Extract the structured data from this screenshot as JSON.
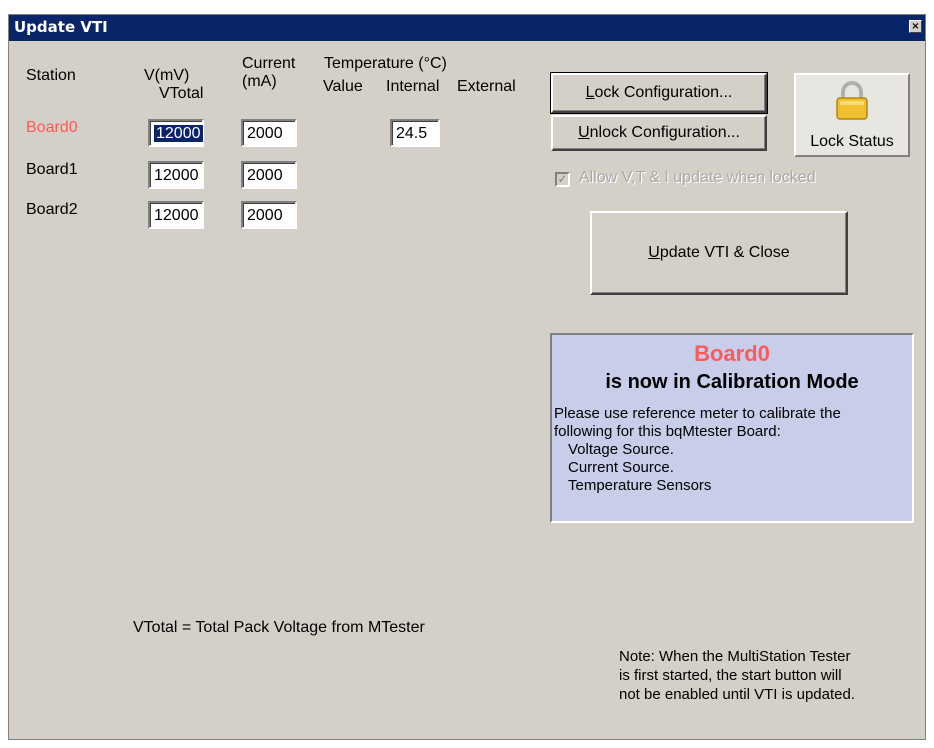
{
  "window": {
    "title": "Update VTI",
    "close_symbol": "×"
  },
  "headers": {
    "station": "Station",
    "voltage_line1": "V(mV)",
    "voltage_line2": "VTotal",
    "current_line1": "Current",
    "current_line2": "(mA)",
    "temperature": "Temperature (°C)",
    "temp_value": "Value",
    "temp_internal": "Internal",
    "temp_external": "External"
  },
  "boards": [
    {
      "name": "Board0",
      "voltage": "12000",
      "current": "2000",
      "temp_internal": "24.5",
      "highlight_color": "#ff5a5a"
    },
    {
      "name": "Board1",
      "voltage": "12000",
      "current": "2000"
    },
    {
      "name": "Board2",
      "voltage": "12000",
      "current": "2000"
    }
  ],
  "buttons": {
    "lock_prefix": "",
    "lock_hotkey": "L",
    "lock_rest": "ock Configuration...",
    "unlock_hotkey": "U",
    "unlock_rest": "nlock Configuration...",
    "update_hotkey": "U",
    "update_rest": "pdate VTI & Close"
  },
  "lock_status": {
    "label": "Lock Status",
    "icon": "padlock-icon"
  },
  "allow_update": {
    "label": "Allow V,T & I update when locked",
    "checked": true,
    "enabled": false
  },
  "calibration": {
    "board": "Board0",
    "mode_text": "is now in Calibration Mode",
    "line1": "Please use reference meter to calibrate the",
    "line2": "following for this bqMtester Board:",
    "item1": "Voltage Source.",
    "item2": "Current Source.",
    "item3": "Temperature Sensors"
  },
  "footnote": "VTotal = Total Pack Voltage from MTester",
  "note": {
    "line1": "Note: When the MultiStation Tester",
    "line2": "is first started, the start button will",
    "line3": "not be enabled until VTI is updated."
  },
  "colors": {
    "titlebar": "#0a246a",
    "dialog": "#d4d0c8",
    "calibration_panel": "#c8cdea",
    "active_board": "#ff5a5a"
  }
}
